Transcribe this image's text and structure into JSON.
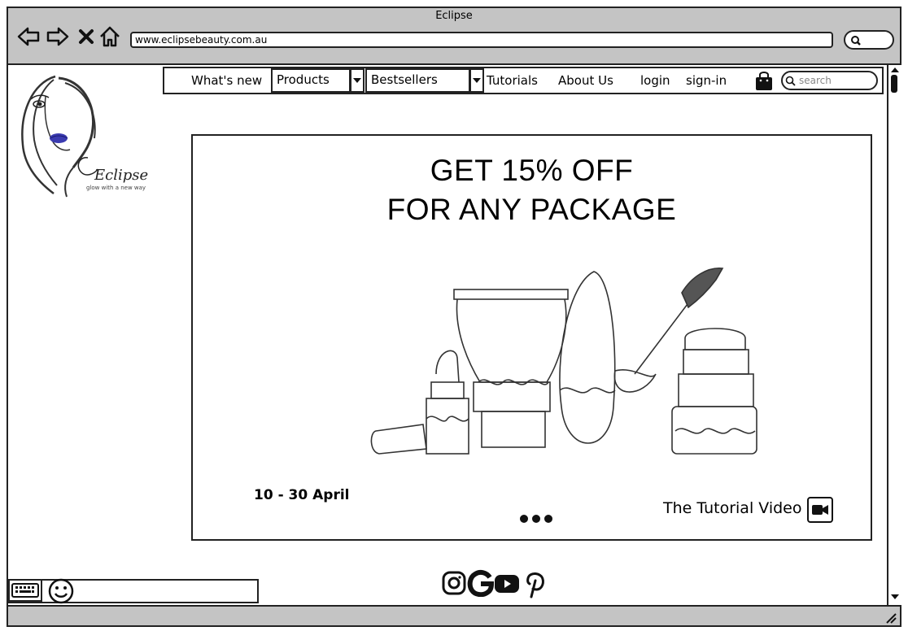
{
  "browser": {
    "title": "Eclipse",
    "url": "www.eclipsebeauty.com.au"
  },
  "logo": {
    "brand": "Eclipse",
    "tagline": "glow with a new way"
  },
  "nav": {
    "whats_new": "What's new",
    "products": "Products",
    "bestsellers": "Bestsellers",
    "tutorials": "Tutorials",
    "about": "About Us",
    "login": "login",
    "signin": "sign-in",
    "search_placeholder": "search"
  },
  "banner": {
    "headline_1": "GET 15% OFF",
    "headline_2": "FOR ANY PACKAGE",
    "date": "10 - 30 April",
    "tutorial_label": "The Tutorial Video"
  },
  "social": [
    "instagram-icon",
    "google-icon",
    "youtube-icon",
    "pinterest-icon"
  ],
  "colors": {
    "chrome": "#c4c4c4",
    "lips": "#3b3bb0",
    "ink": "#222222"
  }
}
